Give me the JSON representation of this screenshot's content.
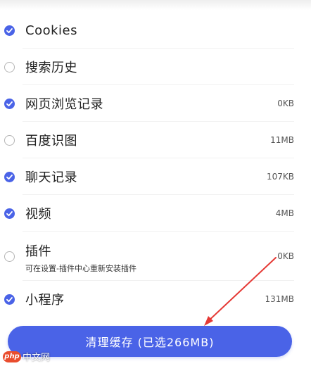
{
  "colors": {
    "accent": "#4a63e7",
    "arrow": "#e53935",
    "unchecked_border": "#b5b5b5"
  },
  "items": [
    {
      "label": "Cookies",
      "size": "",
      "checked": true
    },
    {
      "label": "搜索历史",
      "size": "",
      "checked": false
    },
    {
      "label": "网页浏览记录",
      "size": "0KB",
      "checked": true
    },
    {
      "label": "百度识图",
      "size": "11MB",
      "checked": false
    },
    {
      "label": "聊天记录",
      "size": "107KB",
      "checked": true
    },
    {
      "label": "视频",
      "size": "4MB",
      "checked": true
    },
    {
      "label": "插件",
      "subtext": "可在设置-插件中心重新安装插件",
      "size": "0KB",
      "checked": false
    },
    {
      "label": "小程序",
      "size": "131MB",
      "checked": true
    }
  ],
  "action_button": {
    "label": "清理缓存 (已选266MB)"
  },
  "watermark": {
    "badge": "php",
    "text": "中文网"
  },
  "icons": {
    "checked": "check-circle-icon",
    "unchecked": "empty-circle-icon",
    "arrow": "red-arrow-annotation"
  }
}
